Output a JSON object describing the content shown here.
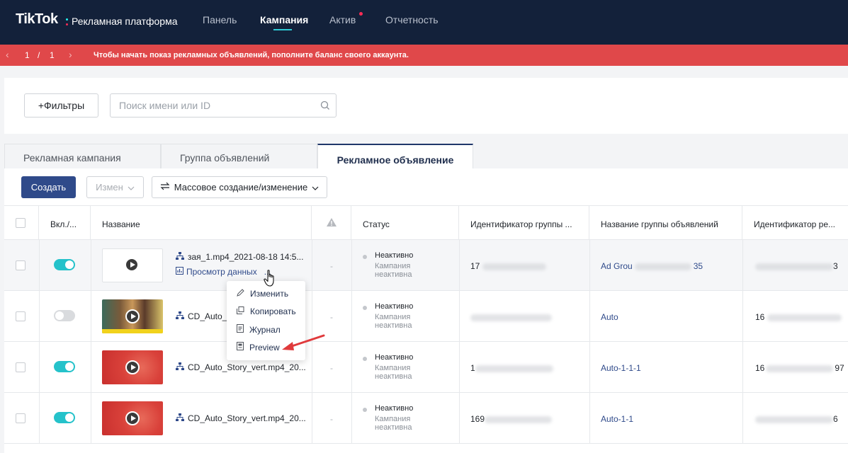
{
  "app": {
    "logo": "TikTok",
    "subtitle": "Рекламная платформа",
    "nav": [
      {
        "label": "Панель"
      },
      {
        "label": "Кампания"
      },
      {
        "label": "Актив"
      },
      {
        "label": "Отчетность"
      }
    ]
  },
  "alert": {
    "page_current": "1",
    "page_sep": "/",
    "page_total": "1",
    "message": "Чтобы начать показ рекламных объявлений, пополните баланс своего аккаунта."
  },
  "filters": {
    "filter_button": "+Фильтры",
    "search_placeholder": "Поиск имени или ID"
  },
  "tabs": [
    {
      "label": "Рекламная кампания"
    },
    {
      "label": "Группа объявлений"
    },
    {
      "label": "Рекламное объявление"
    }
  ],
  "toolbar": {
    "create": "Создать",
    "change": "Измен",
    "mass": "Массовое создание/изменение"
  },
  "table": {
    "columns": [
      "Вкл./...",
      "Название",
      "Статус",
      "Идентификатор группы ...",
      "Название группы объявлений",
      "Идентификатор ре..."
    ],
    "view_data_label": "Просмотр данных",
    "more": "...",
    "rows": [
      {
        "name": "зая_1.mp4_2021-08-18 14:5...",
        "toggle": "on",
        "dash": "-",
        "status": "Неактивно",
        "status_sub_1": "Кампания",
        "status_sub_2": "неактивна",
        "group_id": "17",
        "group_name": "Ad Grou",
        "group_name_tail": "35",
        "ad_id_tail": "3"
      },
      {
        "name": "CD_Auto_l",
        "toggle": "off",
        "dash": "-",
        "status": "Неактивно",
        "status_sub_1": "Кампания",
        "status_sub_2": "неактивна",
        "group_id": "",
        "group_name": "Auto",
        "ad_id": "16"
      },
      {
        "name": "CD_Auto_Story_vert.mp4_20...",
        "toggle": "on",
        "dash": "-",
        "status": "Неактивно",
        "status_sub_1": "Кампания",
        "status_sub_2": "неактивна",
        "group_id": "1",
        "group_name": "Auto-1-1-1",
        "ad_id": "16",
        "ad_id_tail": "97"
      },
      {
        "name": "CD_Auto_Story_vert.mp4_20...",
        "toggle": "on",
        "dash": "-",
        "status": "Неактивно",
        "status_sub_1": "Кампания",
        "status_sub_2": "неактивна",
        "group_id": "169",
        "group_name": "Auto-1-1",
        "ad_id_tail": "6"
      }
    ]
  },
  "context_menu": {
    "items": [
      {
        "label": "Изменить",
        "icon": "pencil-icon"
      },
      {
        "label": "Копировать",
        "icon": "copy-icon"
      },
      {
        "label": "Журнал",
        "icon": "document-icon"
      },
      {
        "label": "Preview",
        "icon": "preview-icon"
      }
    ]
  },
  "colors": {
    "nav_bg": "#13213a",
    "alert_bg": "#e0484a",
    "primary": "#2f4a8a",
    "toggle_on": "#25c2ca",
    "annotation_arrow": "#e03a3c"
  }
}
